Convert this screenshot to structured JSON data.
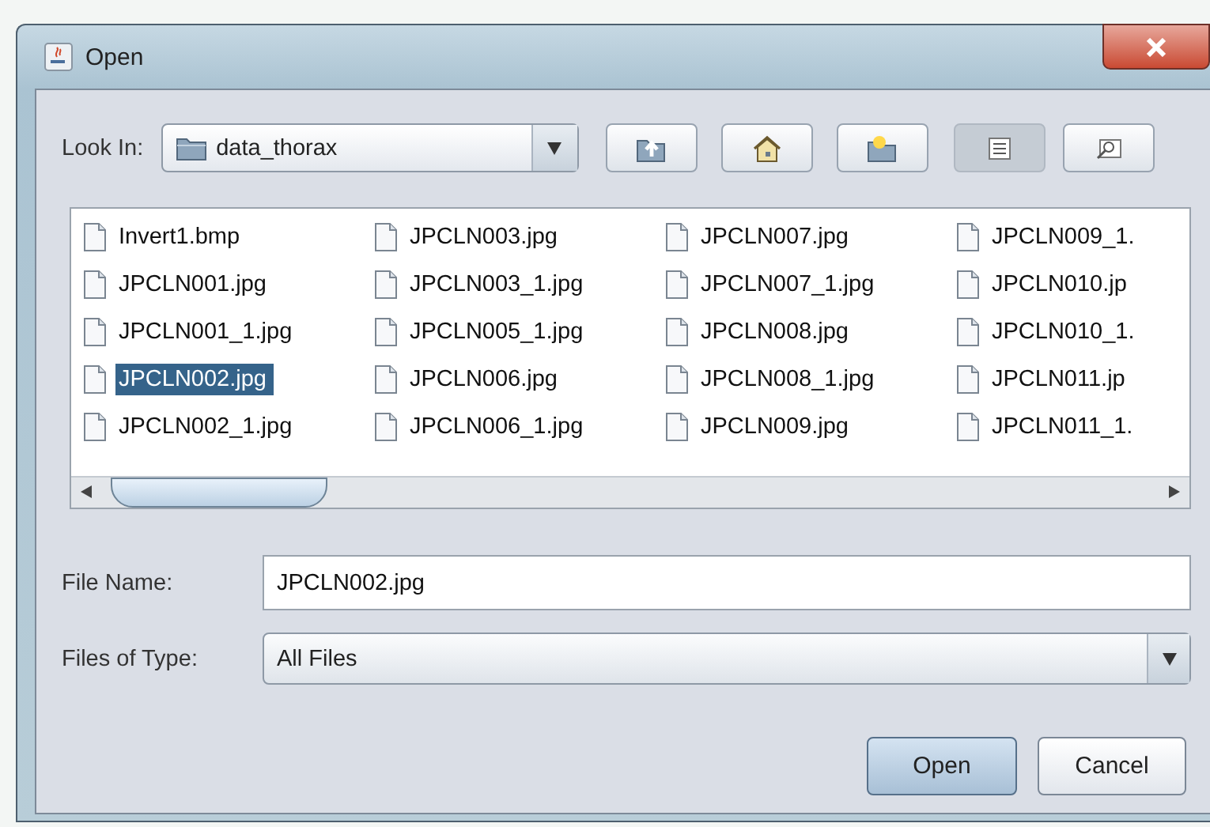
{
  "window": {
    "title": "Open"
  },
  "look_in": {
    "label": "Look In:",
    "value": "data_thorax"
  },
  "toolbar": [
    {
      "kind": "up",
      "selected": false
    },
    {
      "kind": "home",
      "selected": false
    },
    {
      "kind": "new_folder",
      "selected": false
    },
    {
      "kind": "list",
      "selected": true
    },
    {
      "kind": "details",
      "selected": false
    }
  ],
  "files": [
    {
      "name": "Invert1.bmp",
      "selected": false
    },
    {
      "name": "JPCLN001.jpg",
      "selected": false
    },
    {
      "name": "JPCLN001_1.jpg",
      "selected": false
    },
    {
      "name": "JPCLN002.jpg",
      "selected": true
    },
    {
      "name": "JPCLN002_1.jpg",
      "selected": false
    },
    {
      "name": "JPCLN003.jpg",
      "selected": false
    },
    {
      "name": "JPCLN003_1.jpg",
      "selected": false
    },
    {
      "name": "JPCLN005_1.jpg",
      "selected": false
    },
    {
      "name": "JPCLN006.jpg",
      "selected": false
    },
    {
      "name": "JPCLN006_1.jpg",
      "selected": false
    },
    {
      "name": "JPCLN007.jpg",
      "selected": false
    },
    {
      "name": "JPCLN007_1.jpg",
      "selected": false
    },
    {
      "name": "JPCLN008.jpg",
      "selected": false
    },
    {
      "name": "JPCLN008_1.jpg",
      "selected": false
    },
    {
      "name": "JPCLN009.jpg",
      "selected": false
    },
    {
      "name": "JPCLN009_1.",
      "selected": false
    },
    {
      "name": "JPCLN010.jp",
      "selected": false
    },
    {
      "name": "JPCLN010_1.",
      "selected": false
    },
    {
      "name": "JPCLN011.jp",
      "selected": false
    },
    {
      "name": "JPCLN011_1.",
      "selected": false
    }
  ],
  "file_name": {
    "label": "File Name:",
    "value": "JPCLN002.jpg"
  },
  "file_type": {
    "label": "Files of Type:",
    "value": "All Files"
  },
  "buttons": [
    {
      "label": "Open",
      "default": true
    },
    {
      "label": "Cancel",
      "default": false
    }
  ]
}
